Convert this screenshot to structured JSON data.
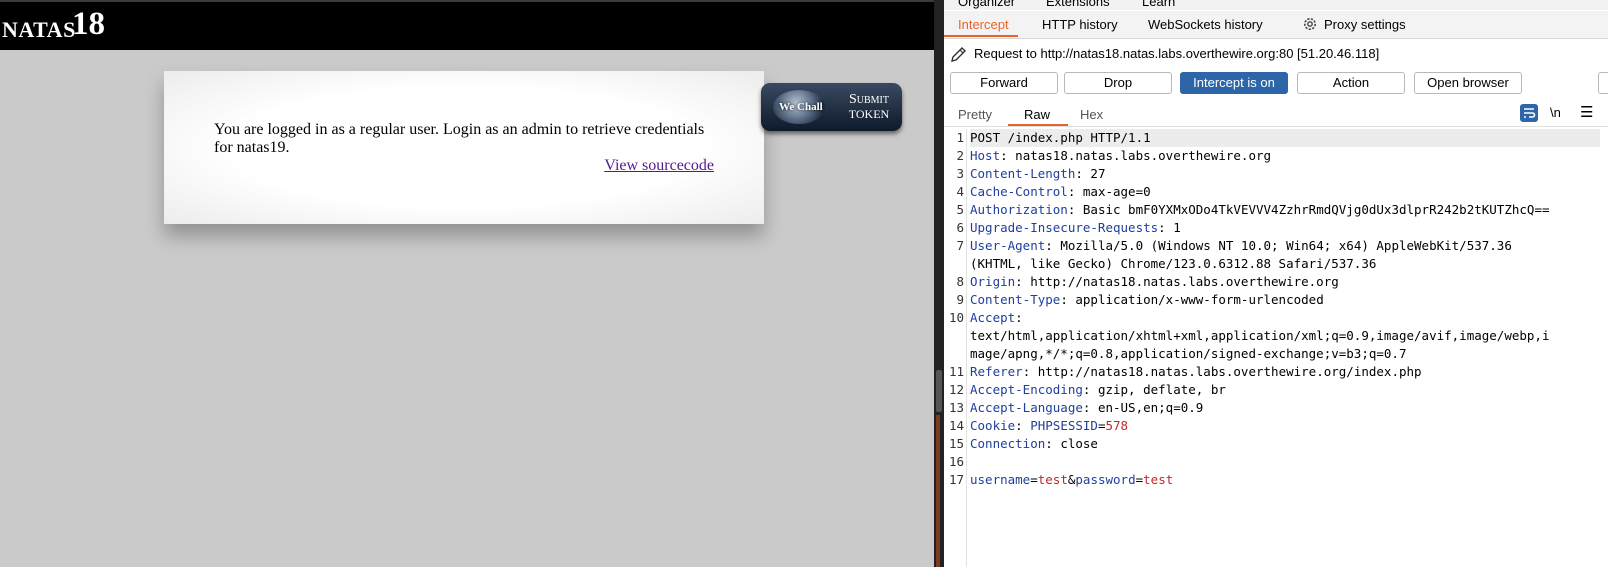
{
  "browser": {
    "header": {
      "prefix": "NATAS",
      "number": "18"
    },
    "message": "You are logged in as a regular user. Login as an admin to retrieve credentials for natas19.",
    "view_source": "View sourcecode",
    "wechall": {
      "logo_text": "We Chall",
      "submit": "Submit",
      "token": "TOKEN"
    }
  },
  "burp": {
    "top_tabs": [
      "Organizer",
      "Extensions",
      "Learn"
    ],
    "sub_tabs": [
      "Intercept",
      "HTTP history",
      "WebSockets history"
    ],
    "proxy_settings": "Proxy settings",
    "request_line": "Request to http://natas18.natas.labs.overthewire.org:80  [51.20.46.118]",
    "buttons": {
      "forward": "Forward",
      "drop": "Drop",
      "intercept": "Intercept is on",
      "action": "Action",
      "open_browser": "Open browser"
    },
    "view_tabs": [
      "Pretty",
      "Raw",
      "Hex"
    ],
    "newline_toggle": "\\n",
    "request": {
      "line1": "POST /index.php HTTP/1.1",
      "headers": [
        {
          "name": "Host",
          "value": " natas18.natas.labs.overthewire.org"
        },
        {
          "name": "Content-Length",
          "value": " 27"
        },
        {
          "name": "Cache-Control",
          "value": " max-age=0"
        },
        {
          "name": "Authorization",
          "value": " Basic bmF0YXMxODo4TkVEVVV4ZzhrRmdQVjg0dUx3dlprR242b2tKUTZhcQ=="
        },
        {
          "name": "Upgrade-Insecure-Requests",
          "value": " 1"
        },
        {
          "name": "User-Agent",
          "value": " Mozilla/5.0 (Windows NT 10.0; Win64; x64) AppleWebKit/537.36",
          "cont": "(KHTML, like Gecko) Chrome/123.0.6312.88 Safari/537.36"
        },
        {
          "name": "Origin",
          "value": " http://natas18.natas.labs.overthewire.org"
        },
        {
          "name": "Content-Type",
          "value": " application/x-www-form-urlencoded"
        },
        {
          "name": "Accept",
          "value": "",
          "cont": "text/html,application/xhtml+xml,application/xml;q=0.9,image/avif,image/webp,i",
          "cont2": "mage/apng,*/*;q=0.8,application/signed-exchange;v=b3;q=0.7"
        },
        {
          "name": "Referer",
          "value": " http://natas18.natas.labs.overthewire.org/index.php"
        },
        {
          "name": "Accept-Encoding",
          "value": " gzip, deflate, br"
        },
        {
          "name": "Accept-Language",
          "value": " en-US,en;q=0.9"
        }
      ],
      "cookie": {
        "name": "Cookie",
        "key": "PHPSESSID",
        "value": "578"
      },
      "connection": {
        "name": "Connection",
        "value": " close"
      },
      "body": {
        "k1": "username",
        "v1": "test",
        "k2": "password",
        "v2": "test"
      },
      "line_numbers": [
        "1",
        "2",
        "3",
        "4",
        "5",
        "6",
        "7",
        "8",
        "9",
        "10",
        "11",
        "12",
        "13",
        "14",
        "15",
        "16",
        "17"
      ]
    }
  }
}
